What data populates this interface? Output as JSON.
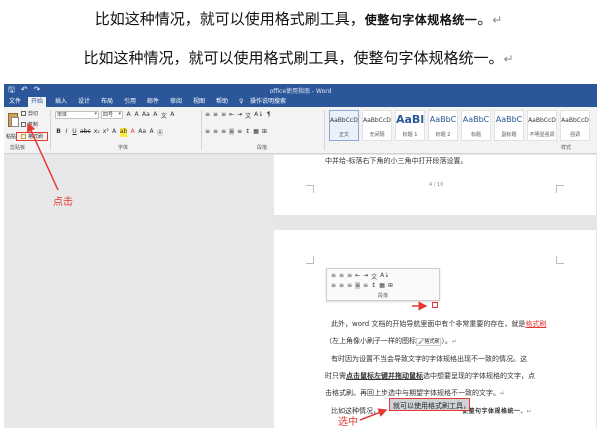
{
  "top_lines": {
    "line1_main": "比如这种情况，就可以使用格式刷工具，",
    "line1_hand": "使整句字体规格统一",
    "line1_end": "。",
    "line2": "比如这种情况，就可以使用格式刷工具，使整句字体规格统一。",
    "return_mark": "↵"
  },
  "word": {
    "qat": {
      "save": "🖫",
      "undo": "↶",
      "redo": "↷"
    },
    "document_title": "office使用指南 - Word",
    "tabs": [
      "文件",
      "开始",
      "插入",
      "设计",
      "布局",
      "引用",
      "邮件",
      "审阅",
      "视图",
      "帮助",
      "♀",
      "操作说明搜索"
    ],
    "active_tab": "开始",
    "clipboard": {
      "paste": "粘贴",
      "cut": "剪切",
      "copy": "复制",
      "format_painter": "格式刷",
      "group_label": "剪贴板"
    },
    "font": {
      "font_name": "宋体",
      "font_size": "四号",
      "group_label": "字体",
      "row1_icons": [
        "A",
        "A",
        "Aa",
        "A",
        "文",
        "A"
      ],
      "row2_icons": [
        "B",
        "I",
        "U",
        "abc",
        "x₂",
        "x²",
        "A",
        "ab",
        "A",
        "Aa",
        "A",
        "Ⓐ"
      ]
    },
    "paragraph": {
      "group_label": "段落",
      "row1_icons": [
        "≡",
        "≡",
        "≡",
        "⇤",
        "⇥",
        "文",
        "A↓",
        "¶"
      ],
      "row2_icons": [
        "≡",
        "≡",
        "≡",
        "≡",
        "≡",
        "↕",
        "▦",
        "⊞"
      ]
    },
    "styles": {
      "group_label": "样式",
      "items": [
        {
          "sample": "AaBbCcDc",
          "name": "正文",
          "selected": true,
          "variant": "normal"
        },
        {
          "sample": "AaBbCcDc",
          "name": "无间隔",
          "selected": false,
          "variant": "normal"
        },
        {
          "sample": "AaBl",
          "name": "标题 1",
          "selected": false,
          "variant": "big"
        },
        {
          "sample": "AaBbC",
          "name": "标题 2",
          "selected": false,
          "variant": "mid"
        },
        {
          "sample": "AaBbC",
          "name": "标题",
          "selected": false,
          "variant": "mid"
        },
        {
          "sample": "AaBbC",
          "name": "副标题",
          "selected": false,
          "variant": "mid"
        },
        {
          "sample": "AaBbCcD",
          "name": "不明显强调",
          "selected": false,
          "variant": "normal"
        },
        {
          "sample": "AaBbCcD",
          "name": "强调",
          "selected": false,
          "variant": "normal"
        }
      ]
    },
    "page1": {
      "text": "中并给-标落右下角的小三角中打开段落设置。",
      "page_number": "4 / 10"
    },
    "minibar": {
      "label": "段落"
    },
    "page2": {
      "para1_a": "此外，word 文档的开始导航里面中有个非常重要的存在，就是",
      "para1_link": "格式刷",
      "para1_b": "（左上角像小刷子一样的图标",
      "para1_icon": "🖌格式刷",
      "para1_c": "）。",
      "para2_a": "有时因为设置不当会导致文字的字体规格出现不一致的情况。这",
      "para2_b": "时只需",
      "para2_bold": "点击鼠标左键并拖动鼠标",
      "para2_c": "选中想要呈现的字体规格的文字，点",
      "para2_d": "击格式刷。再回上步选中与期望字体规格不一致的文字。",
      "para3_a": "比如这种情况，",
      "para3_sel": "就可以使用格式刷工具，",
      "para3_hand": "使整句字体规格统一"
    }
  },
  "annotations": {
    "click": "点击",
    "select": "选中"
  },
  "colors": {
    "word_blue": "#2b579a",
    "annotation_red": "#e53935"
  }
}
